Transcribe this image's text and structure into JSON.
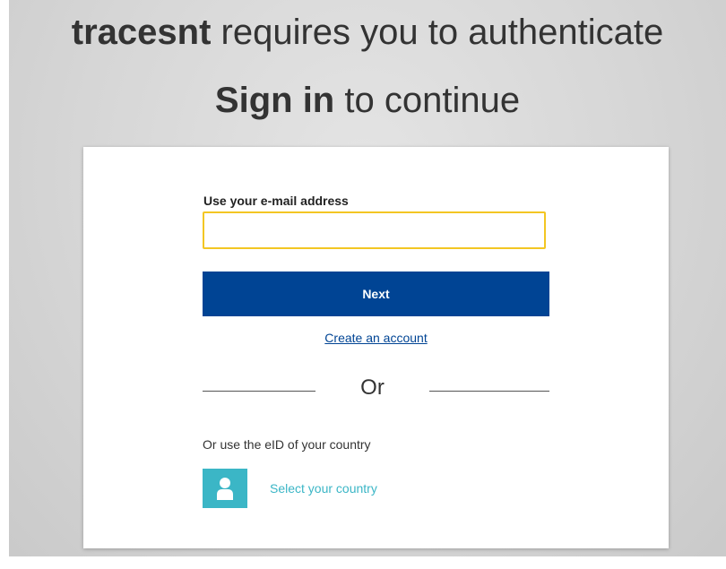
{
  "header": {
    "app_name": "tracesnt",
    "title_rest": " requires you to authenticate",
    "signin_bold": "Sign in",
    "signin_rest": " to continue"
  },
  "form": {
    "email_label": "Use your e-mail address",
    "email_value": "",
    "email_placeholder": "",
    "next_label": "Next",
    "create_account_label": "Create an account",
    "or_label": "Or",
    "eid_label": "Or use the eID of your country",
    "select_country_label": "Select your country",
    "country_icon": "person-icon"
  },
  "colors": {
    "primary": "#004494",
    "input_focus_border": "#f3c623",
    "eid_accent": "#3bb6c6"
  }
}
